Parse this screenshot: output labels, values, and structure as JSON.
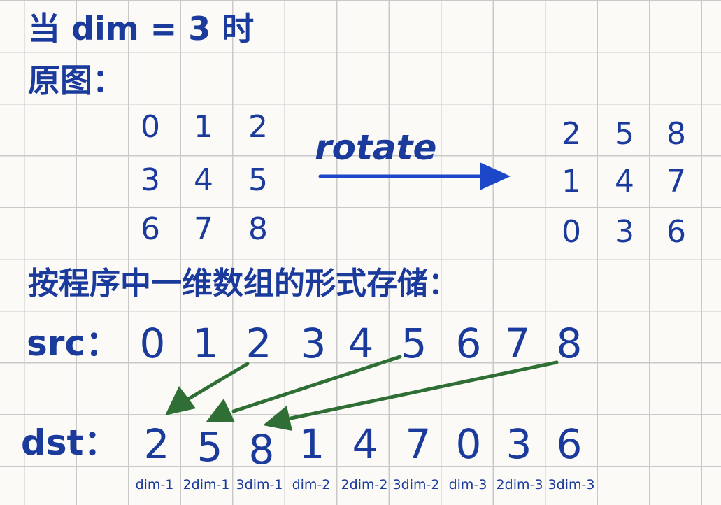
{
  "title": "当 dim = 3 时",
  "original_label": "原图：",
  "source_matrix": [
    [
      "0",
      "1",
      "2"
    ],
    [
      "3",
      "4",
      "5"
    ],
    [
      "6",
      "7",
      "8"
    ]
  ],
  "rotate_label": "rotate",
  "rotated_matrix": [
    [
      "2",
      "5",
      "8"
    ],
    [
      "1",
      "4",
      "7"
    ],
    [
      "0",
      "3",
      "6"
    ]
  ],
  "storage_note": "按程序中一维数组的形式存储：",
  "src": {
    "label": "src：",
    "values": [
      "0",
      "1",
      "2",
      "3",
      "4",
      "5",
      "6",
      "7",
      "8"
    ]
  },
  "dst": {
    "label": "dst：",
    "values": [
      "2",
      "5",
      "8",
      "1",
      "4",
      "7",
      "0",
      "3",
      "6"
    ],
    "index_labels": [
      "dim-1",
      "2dim-1",
      "3dim-1",
      "dim-2",
      "2dim-2",
      "3dim-2",
      "dim-3",
      "2dim-3",
      "3dim-3"
    ]
  },
  "colors": {
    "ink": "#1a3a9c",
    "arrow_main": "#1d47c9",
    "arrow_green": "#2f6e34",
    "grid": "#c9c9c9"
  }
}
